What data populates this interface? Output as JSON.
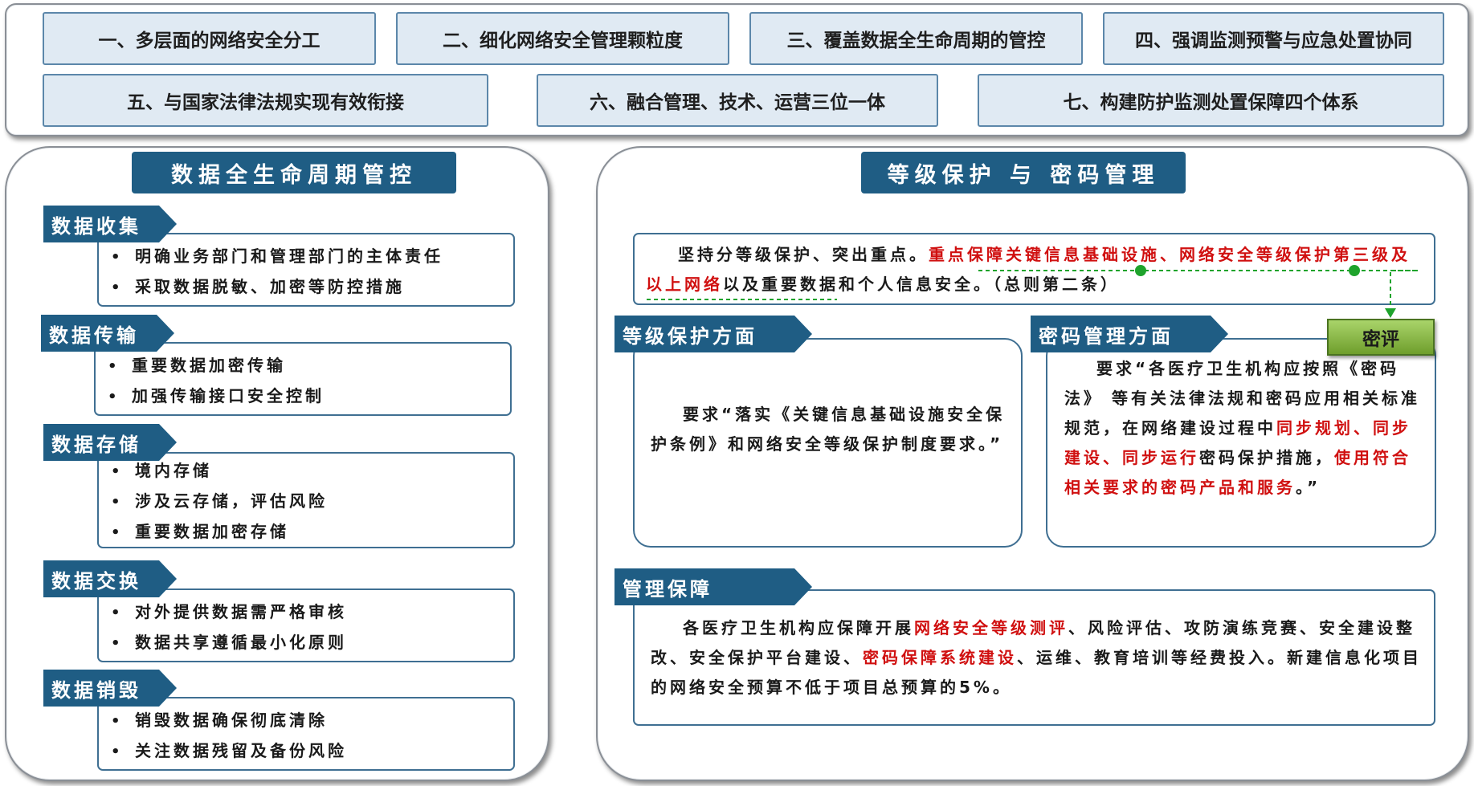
{
  "principles": [
    "一、多层面的网络安全分工",
    "二、细化网络安全管理颗粒度",
    "三、覆盖数据全生命周期的管控",
    "四、强调监测预警与应急处置协同",
    "五、与国家法律法规实现有效衔接",
    "六、融合管理、技术、运营三位一体",
    "七、构建防护监测处置保障四个体系"
  ],
  "lifecycle": {
    "title": "数据全生命周期管控",
    "stages": [
      {
        "label": "数据收集",
        "items": [
          "明确业务部门和管理部门的主体责任",
          "采取数据脱敏、加密等防控措施"
        ]
      },
      {
        "label": "数据传输",
        "items": [
          "重要数据加密传输",
          "加强传输接口安全控制"
        ]
      },
      {
        "label": "数据存储",
        "items": [
          "境内存储",
          "涉及云存储，评估风险",
          "重要数据加密存储"
        ]
      },
      {
        "label": "数据交换",
        "items": [
          "对外提供数据需严格审核",
          "数据共享遵循最小化原则"
        ]
      },
      {
        "label": "数据销毁",
        "items": [
          "销毁数据确保彻底清除",
          "关注数据残留及备份风险"
        ]
      }
    ]
  },
  "protection": {
    "title": "等级保护 与 密码管理",
    "intro": {
      "p1": "坚持分等级保护、突出重点。",
      "p2_red": "重点保障关键信息基础设施、网络安全等级保护第三级及以上网络",
      "p3": "以及重要数据和个人信息安全。（总则第二条）"
    },
    "grade": {
      "label": "等级保护方面",
      "text": "要求“落实《关键信息基础设施安全保护条例》和网络安全等级保护制度要求。”"
    },
    "crypto": {
      "label": "密码管理方面",
      "t1": "要求“各医疗卫生机构应按照《密码法》 等有关法律法规和密码应用相关标准规范，在网络建设过程中",
      "t2_red": "同步规划、同步建设、同步运行",
      "t3": "密码保护措施，",
      "t4_red": "使用符合相关要求的密码产品和服务",
      "t5": "。”"
    },
    "badge": "密评",
    "mgmt": {
      "label": "管理保障",
      "t1": "各医疗卫生机构应保障开展",
      "t2_red": "网络安全等级测评",
      "t3": "、风险评估、攻防演练竞赛、安全建设整改、安全保护平台建设、",
      "t4_red": "密码保障系统建设",
      "t5": "、运维、教育培训等经费投入。新建信息化项目的网络安全预算不低于项目总预算的5%。"
    }
  },
  "colors": {
    "navy": "#1f5d84",
    "principle_fill": "#e0eaf3",
    "emphasis_red": "#d01010",
    "connector_green": "#1ea32c",
    "badge_green": "#8dbd4a"
  }
}
